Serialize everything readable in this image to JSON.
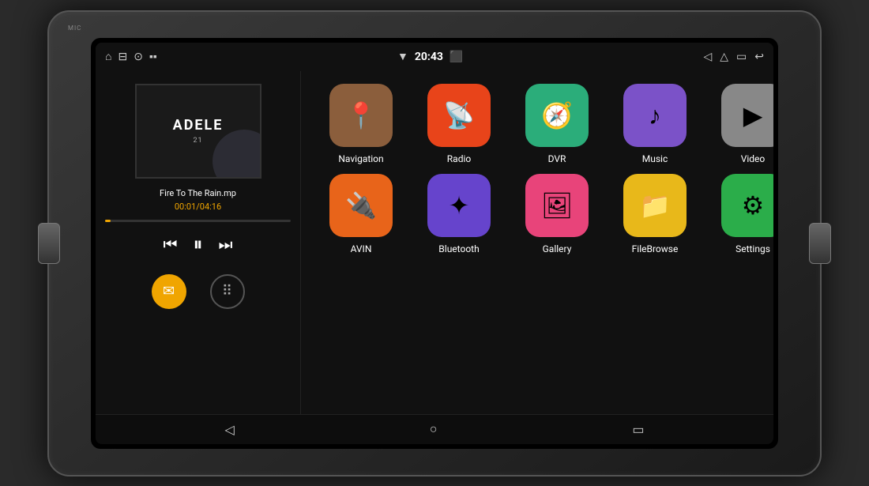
{
  "device": {
    "mic_label": "MIC"
  },
  "status_bar": {
    "left_icons": [
      "⊟",
      "⊙",
      "▪",
      "▪"
    ],
    "wifi_icon": "▼",
    "time": "20:43",
    "camera_icon": "📷",
    "volume_icon": "◁",
    "eject_icon": "△",
    "screen_icon": "▭",
    "back_icon": "↩"
  },
  "music_player": {
    "album_title": "ADELE",
    "track_name": "Fire To The Rain.mp",
    "track_time": "00:01/04:16",
    "progress_percent": 3,
    "prev_icon": "⏮",
    "play_icon": "⏸",
    "next_icon": "⏭"
  },
  "apps": {
    "row1": [
      {
        "id": "navigation",
        "label": "Navigation",
        "color": "bg-brown",
        "icon": "📍"
      },
      {
        "id": "radio",
        "label": "Radio",
        "color": "bg-red",
        "icon": "📡"
      },
      {
        "id": "dvr",
        "label": "DVR",
        "color": "bg-teal",
        "icon": "🧭"
      },
      {
        "id": "music",
        "label": "Music",
        "color": "bg-purple",
        "icon": "♪"
      },
      {
        "id": "video",
        "label": "Video",
        "color": "bg-gray",
        "icon": "▶"
      }
    ],
    "row2": [
      {
        "id": "avin",
        "label": "AVIN",
        "color": "bg-orange",
        "icon": "🔌"
      },
      {
        "id": "bluetooth",
        "label": "Bluetooth",
        "color": "bg-blue-purple",
        "icon": "✦"
      },
      {
        "id": "gallery",
        "label": "Gallery",
        "color": "bg-pink",
        "icon": "🖼"
      },
      {
        "id": "filebrowser",
        "label": "FileBrowse",
        "color": "bg-yellow",
        "icon": "📁"
      },
      {
        "id": "settings",
        "label": "Settings",
        "color": "bg-green",
        "icon": "⚙"
      }
    ]
  },
  "bottom_nav": {
    "back_icon": "◁",
    "home_icon": "○",
    "recent_icon": "▭"
  }
}
